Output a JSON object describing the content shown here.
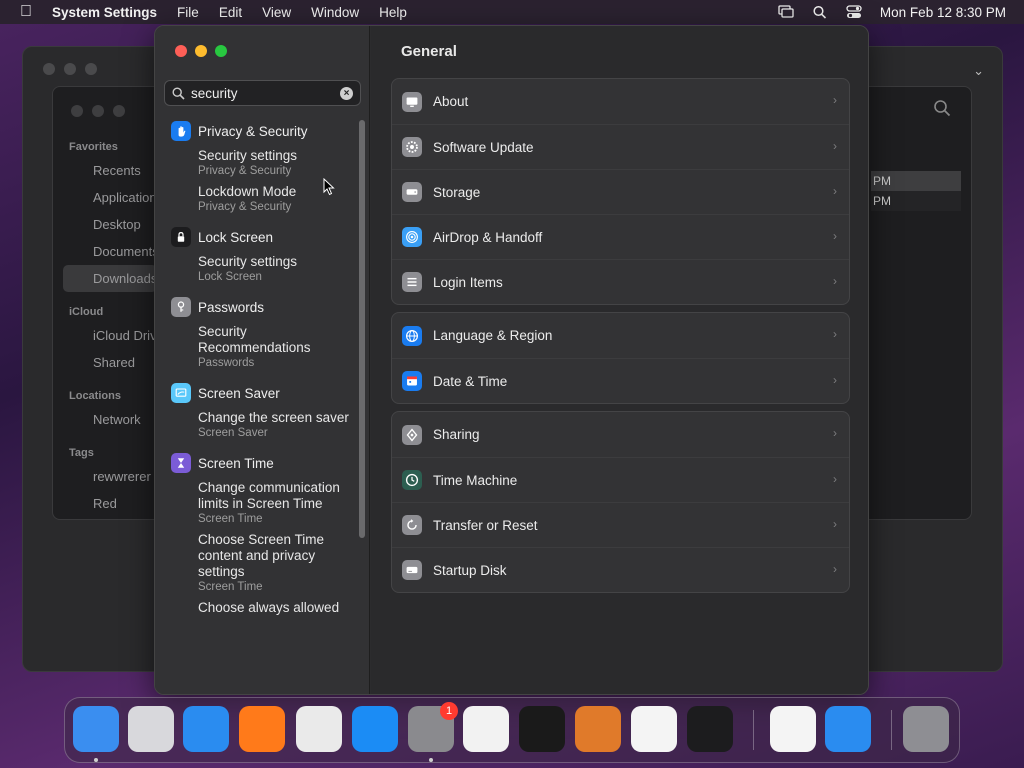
{
  "menubar": {
    "app_name": "System Settings",
    "menus": [
      "File",
      "Edit",
      "View",
      "Window",
      "Help"
    ],
    "datetime": "Mon Feb 12  8:30 PM"
  },
  "finder": {
    "sidebar": [
      {
        "type": "head",
        "label": "Favorites"
      },
      {
        "type": "item",
        "label": "Recents"
      },
      {
        "type": "item",
        "label": "Applications"
      },
      {
        "type": "item",
        "label": "Desktop"
      },
      {
        "type": "item",
        "label": "Documents"
      },
      {
        "type": "item",
        "label": "Downloads",
        "selected": true
      },
      {
        "type": "head",
        "label": "iCloud"
      },
      {
        "type": "item",
        "label": "iCloud Drive"
      },
      {
        "type": "item",
        "label": "Shared"
      },
      {
        "type": "head",
        "label": "Locations"
      },
      {
        "type": "item",
        "label": "Network"
      },
      {
        "type": "head",
        "label": "Tags"
      },
      {
        "type": "item",
        "label": "rewwrerer"
      },
      {
        "type": "item",
        "label": "Red"
      }
    ],
    "row_times": [
      "PM",
      "PM"
    ]
  },
  "search": {
    "value": "security",
    "placeholder": "Search"
  },
  "results": [
    {
      "category": "Privacy & Security",
      "icon": "hand-icon",
      "color": "#1a7cf0",
      "items": [
        {
          "title": "Security settings",
          "sub": "Privacy & Security"
        },
        {
          "title": "Lockdown Mode",
          "sub": "Privacy & Security"
        }
      ]
    },
    {
      "category": "Lock Screen",
      "icon": "lock-icon",
      "color": "#1c1c1e",
      "items": [
        {
          "title": "Security settings",
          "sub": "Lock Screen"
        }
      ]
    },
    {
      "category": "Passwords",
      "icon": "key-icon",
      "color": "#8e8e93",
      "items": [
        {
          "title": "Security Recommendations",
          "sub": "Passwords"
        }
      ]
    },
    {
      "category": "Screen Saver",
      "icon": "screensaver-icon",
      "color": "#5ac8fa",
      "items": [
        {
          "title": "Change the screen saver",
          "sub": "Screen Saver"
        }
      ]
    },
    {
      "category": "Screen Time",
      "icon": "hourglass-icon",
      "color": "#7b5cd6",
      "items": [
        {
          "title": "Change communication limits in Screen Time",
          "sub": "Screen Time"
        },
        {
          "title": "Choose Screen Time content and privacy settings",
          "sub": "Screen Time"
        },
        {
          "title": "Choose always allowed",
          "sub": ""
        }
      ]
    }
  ],
  "main": {
    "title": "General",
    "groups": [
      [
        {
          "label": "About",
          "icon": "computer-icon",
          "color": "#8e8e93"
        },
        {
          "label": "Software Update",
          "icon": "gear-icon",
          "color": "#8e8e93"
        },
        {
          "label": "Storage",
          "icon": "drive-icon",
          "color": "#8e8e93"
        },
        {
          "label": "AirDrop & Handoff",
          "icon": "airdrop-icon",
          "color": "#3a9ff5"
        },
        {
          "label": "Login Items",
          "icon": "list-icon",
          "color": "#8e8e93"
        }
      ],
      [
        {
          "label": "Language & Region",
          "icon": "globe-icon",
          "color": "#1a7cf0"
        },
        {
          "label": "Date & Time",
          "icon": "calendar-icon",
          "color": "#1a7cf0"
        }
      ],
      [
        {
          "label": "Sharing",
          "icon": "sharing-icon",
          "color": "#8e8e93"
        },
        {
          "label": "Time Machine",
          "icon": "time-machine-icon",
          "color": "#2c5e50"
        },
        {
          "label": "Transfer or Reset",
          "icon": "reset-icon",
          "color": "#8e8e93"
        },
        {
          "label": "Startup Disk",
          "icon": "disk-icon",
          "color": "#8e8e93"
        }
      ]
    ]
  },
  "dock": {
    "apps": [
      {
        "name": "Finder",
        "icon": "finder-icon",
        "color": "#3a8ef0",
        "running": true
      },
      {
        "name": "Launchpad",
        "icon": "launchpad-icon",
        "color": "#d8d8dc",
        "running": false
      },
      {
        "name": "Safari",
        "icon": "safari-icon",
        "color": "#2a8cf0",
        "running": false
      },
      {
        "name": "Firefox",
        "icon": "firefox-icon",
        "color": "#ff7a1a",
        "running": false
      },
      {
        "name": "Chrome",
        "icon": "chrome-icon",
        "color": "#eaeaea",
        "running": false
      },
      {
        "name": "App Store",
        "icon": "app-store-icon",
        "color": "#1b8cf5",
        "running": false
      },
      {
        "name": "System Settings",
        "icon": "system-settings-icon",
        "color": "#8a8a8e",
        "running": true,
        "badge": "1"
      },
      {
        "name": "TextEdit",
        "icon": "textedit-icon",
        "color": "#f2f2f2",
        "running": false
      },
      {
        "name": "Terminal",
        "icon": "terminal-icon",
        "color": "#1a1a1a",
        "running": false
      },
      {
        "name": "GarageBand",
        "icon": "garageband-icon",
        "color": "#e07a2a",
        "running": false
      },
      {
        "name": "VS Code",
        "icon": "vscode-icon",
        "color": "#f4f4f4",
        "running": false
      },
      {
        "name": "Activity Monitor",
        "icon": "activity-monitor-icon",
        "color": "#1c1c1e",
        "running": false
      },
      {
        "name": "Visual Studio",
        "icon": "visual-studio-icon",
        "color": "#f4f4f4",
        "running": false
      },
      {
        "name": "Weather",
        "icon": "weather-icon",
        "color": "#2a8cf0",
        "running": false
      },
      {
        "name": "Trash",
        "icon": "trash-icon",
        "color": "#8e8e93",
        "running": false
      }
    ]
  }
}
